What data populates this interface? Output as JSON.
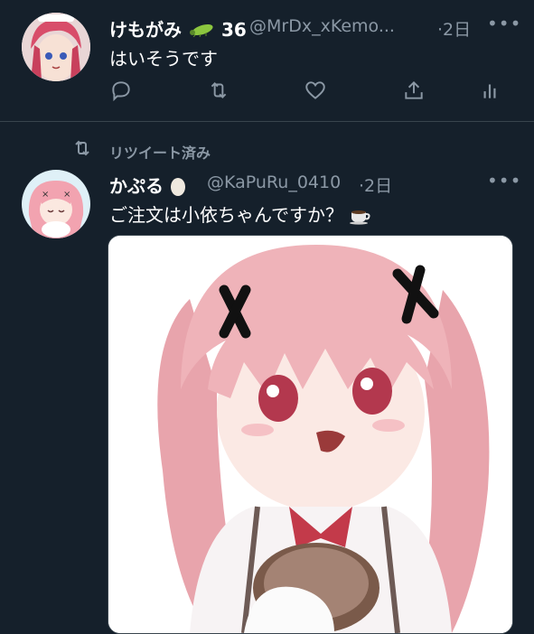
{
  "tweet1": {
    "name": "けもがみ",
    "name_suffix": "36",
    "handle": "@MrDx_xKemo...",
    "time": "·2日",
    "text": "はいそうです"
  },
  "retweet": {
    "label": "リツイート済み"
  },
  "tweet2": {
    "name": "かぷる",
    "handle": "@KaPuRu_0410",
    "time": "·2日",
    "text": "ご注文は小依ちゃんですか？"
  },
  "icons": {
    "reply": "reply-icon",
    "retweet": "retweet-icon",
    "like": "heart-icon",
    "share": "share-icon",
    "analytics": "analytics-icon",
    "more": "more-icon"
  },
  "colors": {
    "background": "#15202b",
    "muted": "#8b98a5",
    "divider": "#38444d"
  }
}
